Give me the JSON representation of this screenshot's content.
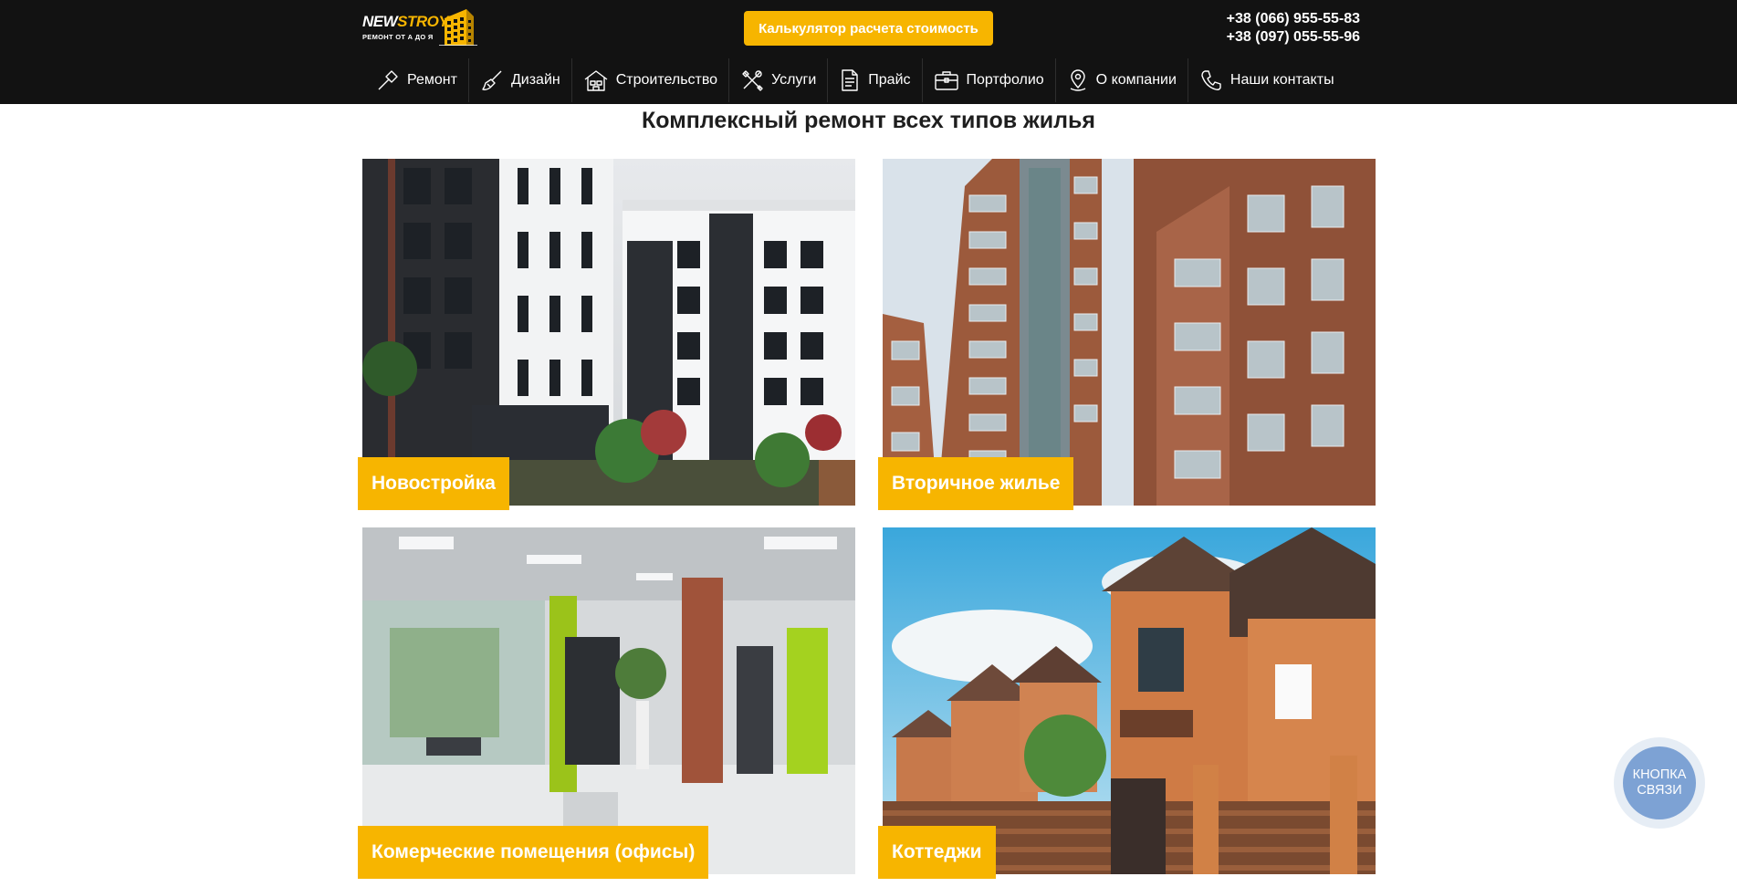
{
  "header": {
    "logo": {
      "brand_part1": "NEW",
      "brand_part2": "STROY",
      "tagline": "РЕМОНТ ОТ А ДО Я"
    },
    "calc_button_label": "Калькулятор расчета стоимость",
    "phones": [
      "+38 (066) 955-55-83",
      "+38 (097) 055-55-96"
    ],
    "nav": [
      {
        "label": "Ремонт",
        "icon": "hammer-icon"
      },
      {
        "label": "Дизайн",
        "icon": "brush-icon"
      },
      {
        "label": "Строительство",
        "icon": "house-icon"
      },
      {
        "label": "Услуги",
        "icon": "tools-icon"
      },
      {
        "label": "Прайс",
        "icon": "document-icon"
      },
      {
        "label": "Портфолио",
        "icon": "briefcase-icon"
      },
      {
        "label": "О компании",
        "icon": "map-pin-icon"
      },
      {
        "label": "Наши контакты",
        "icon": "phone-icon"
      }
    ]
  },
  "main": {
    "title": "Комплексный ремонт всех типов жилья",
    "cards": [
      {
        "label": "Новостройка",
        "image": "new-building-photo"
      },
      {
        "label": "Вторичное жилье",
        "image": "secondary-housing-photo"
      },
      {
        "label": "Комерческие помещения (офисы)",
        "image": "office-interior-photo"
      },
      {
        "label": "Коттеджи",
        "image": "cottages-photo"
      }
    ]
  },
  "contact_widget": {
    "line1": "КНОПКА",
    "line2": "СВЯЗИ"
  },
  "colors": {
    "header_bg": "#121212",
    "accent": "#f7b500",
    "contact_button": "#7da2d4"
  }
}
